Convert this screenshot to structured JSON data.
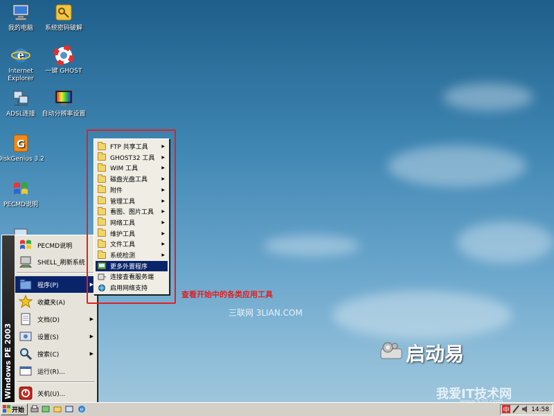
{
  "desktop_icons": [
    {
      "label": "我的电脑",
      "icon": "computer-icon"
    },
    {
      "label": "系统密码破解",
      "icon": "key-icon"
    },
    {
      "label": "Internet Explorer",
      "icon": "ie-icon"
    },
    {
      "label": "一键 GHOST",
      "icon": "lifebuoy-icon"
    },
    {
      "label": "ADSL连接",
      "icon": "network-icon"
    },
    {
      "label": "自动分辨率设置",
      "icon": "display-icon"
    },
    {
      "label": "DiskGenius 3.2",
      "icon": "diskgenius-icon"
    },
    {
      "label": "PECMD说明",
      "icon": "windows-flag-icon"
    }
  ],
  "start_menu": {
    "banner": "Windows PE 2003",
    "pinned": [
      {
        "label": "PECMD说明",
        "icon": "windows-flag-icon"
      },
      {
        "label": "SHELL_刷新系统",
        "icon": "shell-refresh-icon"
      }
    ],
    "items": [
      {
        "label": "程序(P)",
        "icon": "programs-icon",
        "has_submenu": true,
        "active": true
      },
      {
        "label": "收藏夹(A)",
        "icon": "favorites-star-icon",
        "has_submenu": false
      },
      {
        "label": "文档(D)",
        "icon": "documents-icon",
        "has_submenu": true
      },
      {
        "label": "设置(S)",
        "icon": "settings-icon",
        "has_submenu": true
      },
      {
        "label": "搜索(C)",
        "icon": "search-icon",
        "has_submenu": true
      },
      {
        "label": "运行(R)...",
        "icon": "run-icon",
        "has_submenu": false
      }
    ],
    "shutdown": {
      "label": "关机(U)...",
      "icon": "power-icon"
    }
  },
  "submenu": {
    "items": [
      {
        "label": "FTP 共享工具",
        "icon": "folder-icon",
        "arrow": true
      },
      {
        "label": "GHOST32 工具",
        "icon": "folder-icon",
        "arrow": true
      },
      {
        "label": "WIM 工具",
        "icon": "folder-icon",
        "arrow": true
      },
      {
        "label": "磁盘光盘工具",
        "icon": "folder-icon",
        "arrow": true
      },
      {
        "label": "附件",
        "icon": "folder-icon",
        "arrow": true
      },
      {
        "label": "管理工具",
        "icon": "folder-icon",
        "arrow": true
      },
      {
        "label": "看图、图片工具",
        "icon": "folder-icon",
        "arrow": true
      },
      {
        "label": "网络工具",
        "icon": "folder-icon",
        "arrow": true
      },
      {
        "label": "维护工具",
        "icon": "folder-icon",
        "arrow": true
      },
      {
        "label": "文件工具",
        "icon": "folder-icon",
        "arrow": true
      },
      {
        "label": "系统检测",
        "icon": "folder-icon",
        "arrow": true
      },
      {
        "label": "更多外置程序",
        "icon": "external-programs-icon",
        "arrow": false,
        "active": true
      },
      {
        "label": "连接查看服务端",
        "icon": "connect-icon",
        "arrow": false
      },
      {
        "label": "启用网络支持",
        "icon": "globe-icon",
        "arrow": false
      }
    ]
  },
  "annotation": "查看开始中的各类应用工具",
  "watermarks": {
    "site": "三联网 3LIAN.COM",
    "brand": "启动易",
    "site2": "我爱IT技术网",
    "site2_url": "www.52ij.com"
  },
  "taskbar": {
    "start_label": "开始",
    "clock": "14:58"
  },
  "colors": {
    "highlight": "#0a246a",
    "annotation_red": "#e02020"
  }
}
